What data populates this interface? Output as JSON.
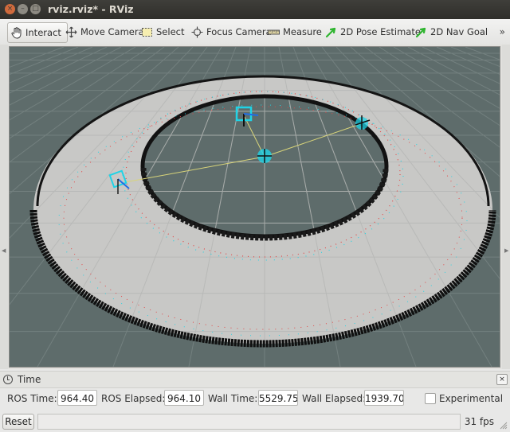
{
  "window": {
    "title": "rviz.rviz* - RViz",
    "controls": {
      "close": "×",
      "minimize": "–",
      "maximize": "□"
    }
  },
  "toolbar": {
    "tools": [
      {
        "label": "Interact",
        "icon": "hand-icon",
        "active": true
      },
      {
        "label": "Move Camera",
        "icon": "move-arrows-icon"
      },
      {
        "label": "Select",
        "icon": "select-rect-icon"
      },
      {
        "label": "Focus Camera",
        "icon": "crosshair-icon"
      },
      {
        "label": "Measure",
        "icon": "ruler-icon"
      },
      {
        "label": "2D Pose Estimate",
        "icon": "green-arrow-icon"
      },
      {
        "label": "2D Nav Goal",
        "icon": "green-arrow-icon"
      }
    ],
    "overflow": "»"
  },
  "viewport": {
    "background": "#5e6c6b",
    "grid_color": "#727e7d",
    "floor_color": "#c9c9c7",
    "wall_color": "#111111",
    "robot_color": "#1fd3e6",
    "path_color": "#d8d47a"
  },
  "time_panel": {
    "title": "Time",
    "close": "×",
    "ros_time_label": "ROS Time:",
    "ros_time_value": "964.40",
    "ros_elapsed_label": "ROS Elapsed:",
    "ros_elapsed_value": "964.10",
    "wall_time_label": "Wall Time:",
    "wall_time_value": "5529.75",
    "wall_elapsed_label": "Wall Elapsed:",
    "wall_elapsed_value": "1939.70",
    "experimental_label": "Experimental",
    "experimental_checked": false
  },
  "status_bar": {
    "reset_label": "Reset",
    "fps": "31 fps"
  }
}
